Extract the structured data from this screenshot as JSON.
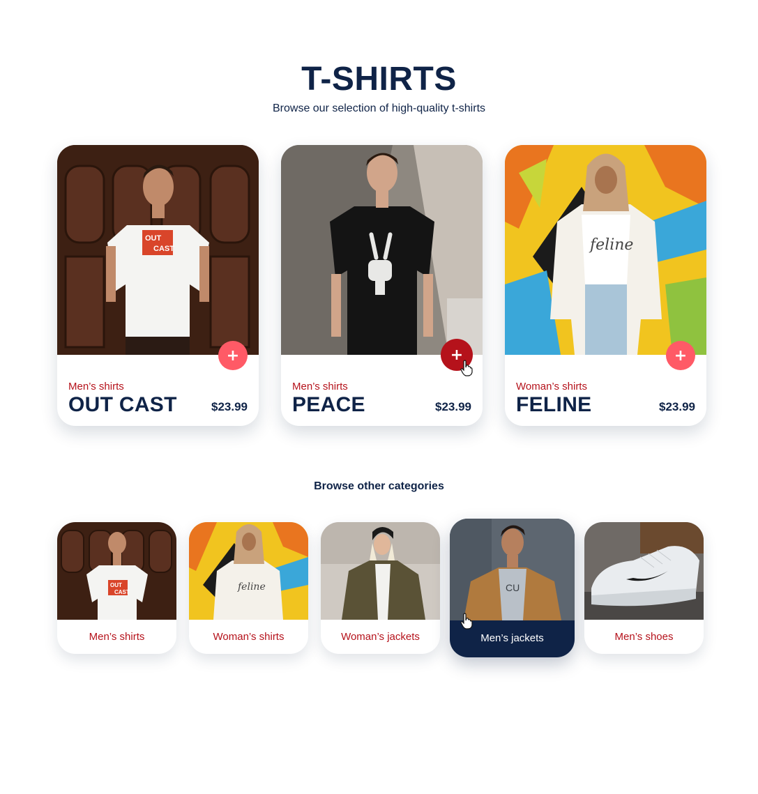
{
  "header": {
    "title": "T-SHIRTS",
    "subtitle": "Browse our selection of high-quality t-shirts"
  },
  "products": [
    {
      "category": "Men’s shirts",
      "name": "OUT CAST",
      "price": "$23.99",
      "add_label": "+",
      "image": "man-white-tshirt-photo",
      "shirt_print": "OUT CAST"
    },
    {
      "category": "Men’s shirts",
      "name": "PEACE",
      "price": "$23.99",
      "add_label": "+",
      "image": "man-black-tshirt-photo"
    },
    {
      "category": "Woman’s shirts",
      "name": "FELINE",
      "price": "$23.99",
      "add_label": "+",
      "image": "woman-feline-tshirt-photo",
      "shirt_print": "feline"
    }
  ],
  "categories_section": {
    "heading": "Browse other categories",
    "items": [
      {
        "label": "Men’s shirts",
        "image": "men-shirts-photo"
      },
      {
        "label": "Woman’s shirts",
        "image": "woman-shirts-photo"
      },
      {
        "label": "Woman’s jackets",
        "image": "woman-jackets-photo"
      },
      {
        "label": "Men’s jackets",
        "image": "men-jackets-photo",
        "selected": true
      },
      {
        "label": "Men’s shoes",
        "image": "men-shoes-photo"
      }
    ]
  },
  "colors": {
    "navy": "#0f2347",
    "accent_red": "#b5121b",
    "add_button": "#ff5a66",
    "background": "#ffffff"
  }
}
